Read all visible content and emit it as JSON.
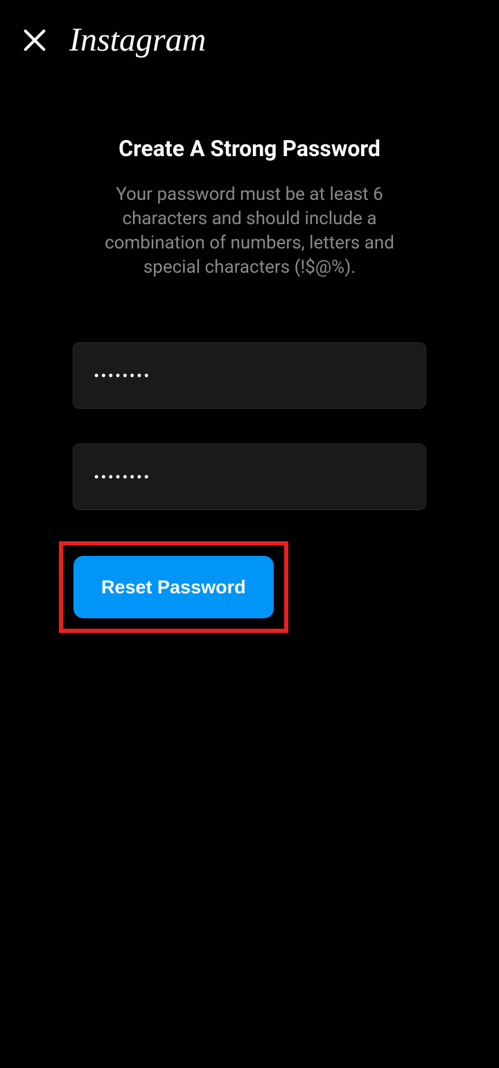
{
  "header": {
    "logo": "Instagram"
  },
  "main": {
    "title": "Create A Strong Password",
    "description": "Your password must be at least 6 characters and should include a combination of numbers, letters and special characters (!$@%).",
    "password_value": "••••••••",
    "confirm_password_value": "••••••••",
    "reset_button_label": "Reset Password"
  },
  "annotation": {
    "highlight_color": "#e82020"
  }
}
